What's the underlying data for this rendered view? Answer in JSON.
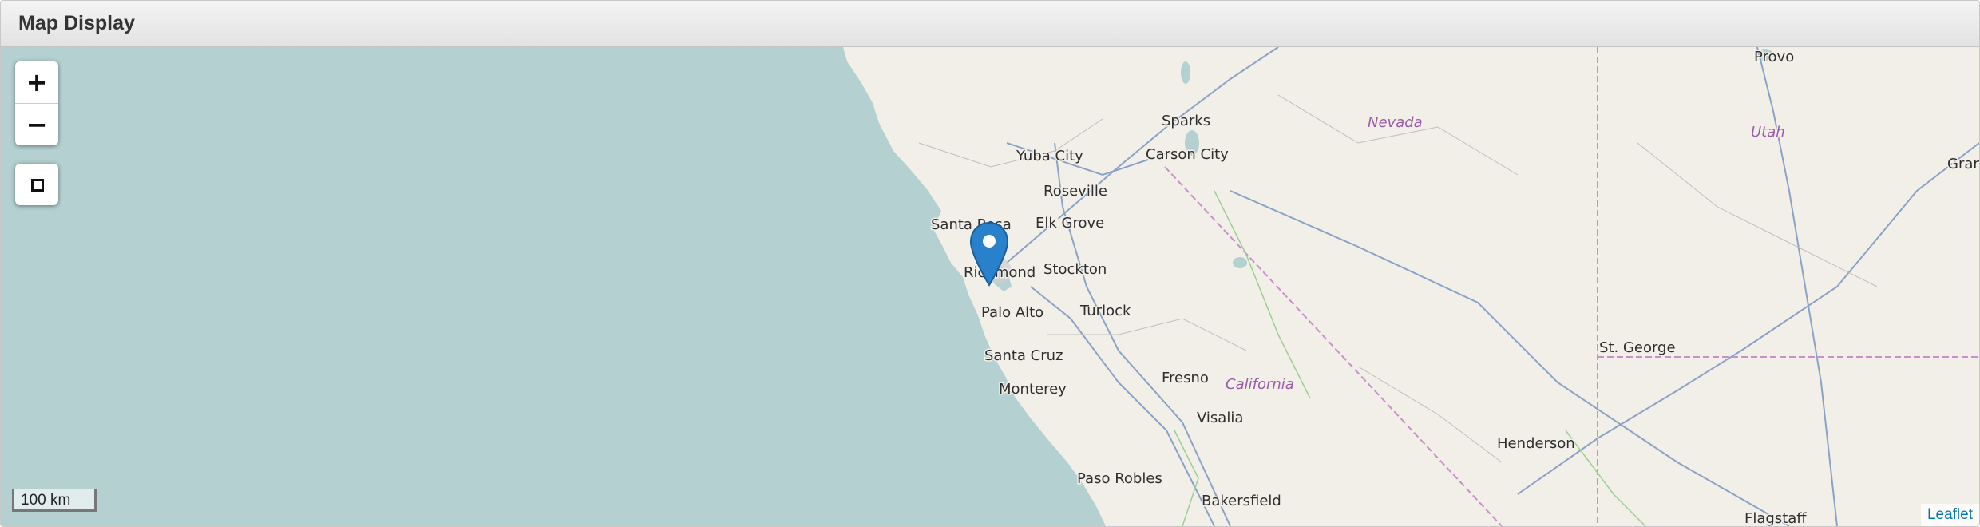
{
  "panel": {
    "title": "Map Display"
  },
  "map": {
    "controls": {
      "zoom_in": "+",
      "zoom_out": "−"
    },
    "scale_label": "100 km",
    "attribution": "Leaflet",
    "colors": {
      "water": "#b5d0d0",
      "land": "#f2efe9",
      "marker": "#2a81cb",
      "state_label": "#9a5ba8",
      "attribution_link": "#0078a8"
    },
    "regions": [
      "Nevada",
      "Utah",
      "California"
    ],
    "places": [
      "Provo",
      "Sparks",
      "Carson City",
      "Yuba City",
      "Roseville",
      "Gran",
      "Santa Rosa",
      "Elk Grove",
      "Richmond",
      "Stockton",
      "Turlock",
      "Palo Alto",
      "St. George",
      "Santa Cruz",
      "Fresno",
      "Monterey",
      "Visalia",
      "Henderson",
      "Paso Robles",
      "Bakersfield",
      "Flagstaff"
    ]
  }
}
